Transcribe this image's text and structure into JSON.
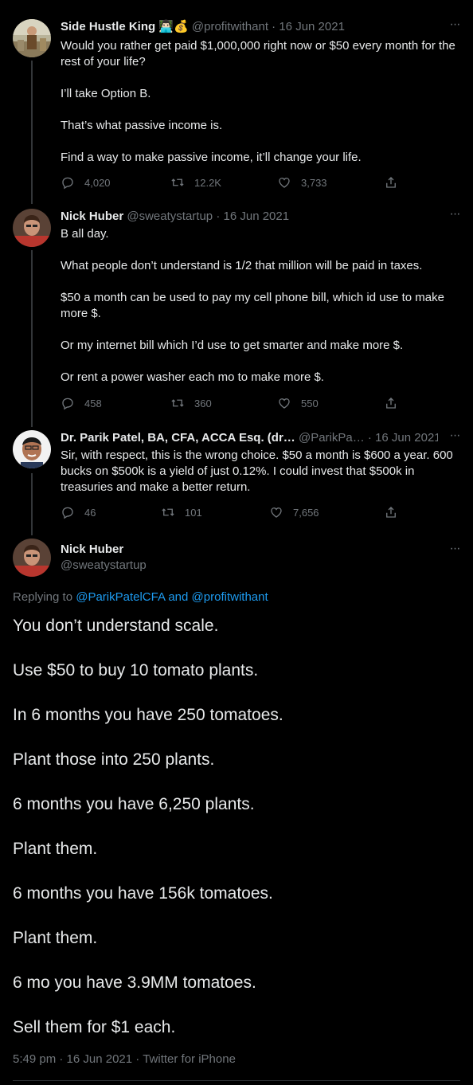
{
  "tweets": [
    {
      "name": "Side Hustle King",
      "name_emoji": "👨🏻‍💻💰",
      "handle": "@profitwithant",
      "separator": "·",
      "date": "16 Jun 2021",
      "paragraphs": [
        "Would you rather get paid $1,000,000 right now or $50 every month for the rest of your life?",
        "I’ll take Option B.",
        "That’s what passive income is.",
        "Find a way to make passive income, it’ll change your life."
      ],
      "stats": {
        "replies": "4,020",
        "retweets": "12.2K",
        "likes": "3,733"
      }
    },
    {
      "name": "Nick Huber",
      "handle": "@sweatystartup",
      "separator": "·",
      "date": "16 Jun 2021",
      "paragraphs": [
        "B all day.",
        "What people don’t understand is 1/2 that million will be paid in taxes.",
        "$50 a month can be used to pay my cell phone bill, which id use to make more $.",
        "Or my internet bill which I’d use to get smarter and make more $.",
        "Or rent a power washer each mo to make more $."
      ],
      "stats": {
        "replies": "458",
        "retweets": "360",
        "likes": "550"
      }
    },
    {
      "name": "Dr. Parik Patel, BA, CFA, ACCA Esq. (dr…",
      "handle": "@ParikPa…",
      "separator": "·",
      "date": "16 Jun 2021",
      "paragraphs": [
        "Sir, with respect, this is the wrong choice. $50 a month is $600 a year. 600 bucks on $500k is a yield of just 0.12%. I could invest that $500k in treasuries and make a better return."
      ],
      "stats": {
        "replies": "46",
        "retweets": "101",
        "likes": "7,656"
      }
    }
  ],
  "main_tweet": {
    "name": "Nick Huber",
    "handle": "@sweatystartup",
    "replying_prefix": "Replying to ",
    "replying_to_1": "@ParikPatelCFA",
    "replying_and": " and ",
    "replying_to_2": "@profitwithant",
    "paragraphs": [
      "You don’t understand scale.",
      "Use $50 to buy 10 tomato plants.",
      "In 6 months you have 250 tomatoes.",
      "Plant those into 250 plants.",
      "6 months you have 6,250 plants.",
      "Plant them.",
      "6 months you have 156k tomatoes.",
      "Plant them.",
      "6 mo you have 3.9MM tomatoes.",
      "Sell them for $1 each."
    ],
    "time": "5:49 pm",
    "date": "16 Jun 2021",
    "source": "Twitter for iPhone",
    "separator": "·"
  },
  "more_glyph": "···",
  "colors": {
    "background": "#000000",
    "text": "#e7e9ea",
    "muted": "#71767b",
    "link": "#1d9bf0",
    "line": "#333639"
  }
}
